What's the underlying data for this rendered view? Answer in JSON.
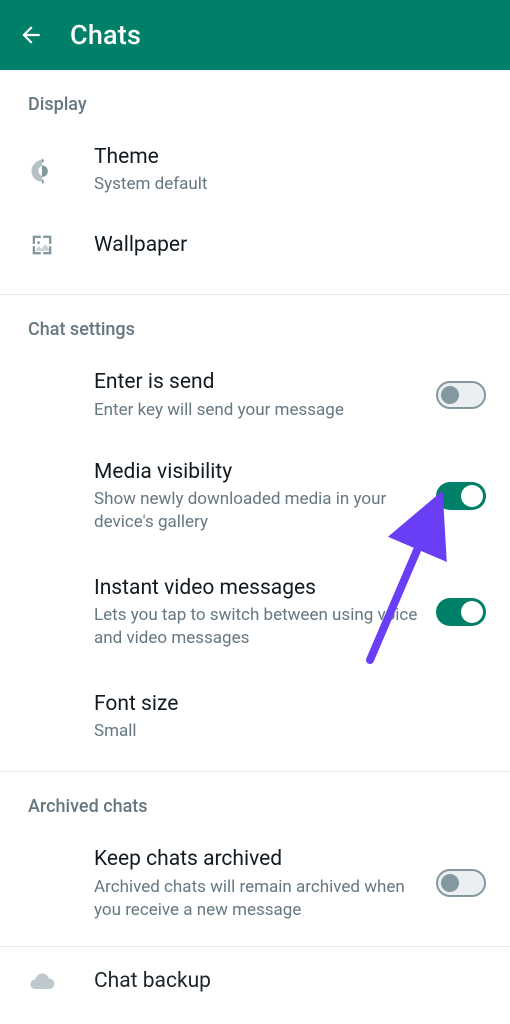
{
  "header": {
    "title": "Chats"
  },
  "sections": {
    "display": {
      "label": "Display"
    },
    "chat_settings": {
      "label": "Chat settings"
    },
    "archived": {
      "label": "Archived chats"
    }
  },
  "theme": {
    "title": "Theme",
    "sub": "System default"
  },
  "wallpaper": {
    "title": "Wallpaper"
  },
  "enter_is_send": {
    "title": "Enter is send",
    "sub": "Enter key will send your message",
    "on": false
  },
  "media_visibility": {
    "title": "Media visibility",
    "sub": "Show newly downloaded media in your device's gallery",
    "on": true
  },
  "instant_video": {
    "title": "Instant video messages",
    "sub": "Lets you tap to switch between using voice and video messages",
    "on": true
  },
  "font_size": {
    "title": "Font size",
    "sub": "Small"
  },
  "keep_archived": {
    "title": "Keep chats archived",
    "sub": "Archived chats will remain archived when you receive a new message",
    "on": false
  },
  "chat_backup": {
    "title": "Chat backup"
  },
  "colors": {
    "accent": "#008069",
    "arrow": "#6a3ef5"
  }
}
